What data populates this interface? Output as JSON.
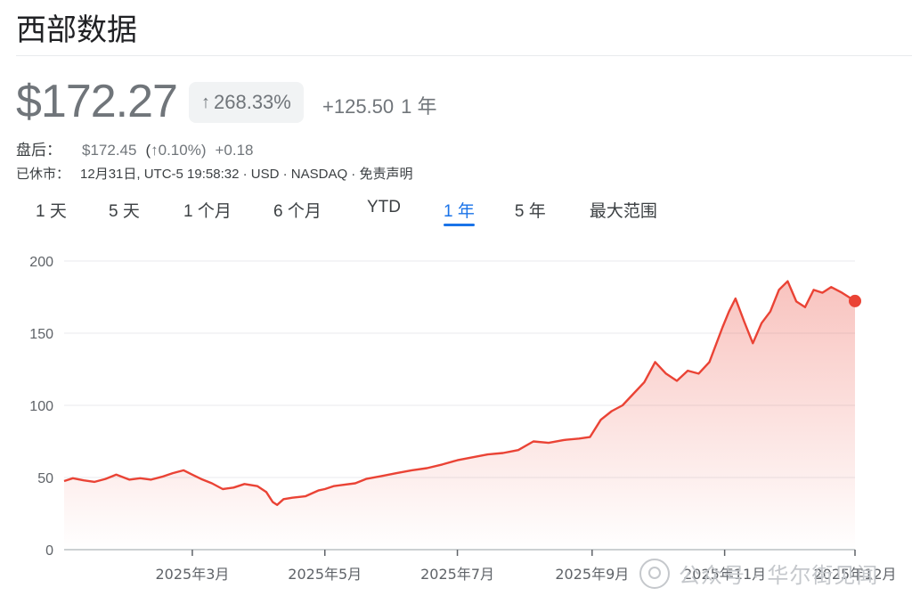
{
  "header": {
    "title": "西部数据"
  },
  "quote": {
    "price": "$172.27",
    "pct_change": "268.33%",
    "abs_change": "+125.50",
    "period": "1 年"
  },
  "after_hours": {
    "label": "盘后：",
    "price": "$172.45",
    "pct_open": "(",
    "pct": "0.10%)",
    "change": "+0.18"
  },
  "status": {
    "label": "已休市：",
    "detail": "12月31日, UTC-5 19:58:32 · USD · NASDAQ · 免责声明"
  },
  "tabs": [
    {
      "label": "1 天"
    },
    {
      "label": "5 天"
    },
    {
      "label": "1 个月"
    },
    {
      "label": "6 个月"
    },
    {
      "label": "YTD"
    },
    {
      "label": "1 年"
    },
    {
      "label": "5 年"
    },
    {
      "label": "最大范围"
    }
  ],
  "watermark": {
    "text": "公众号 · 华尔街见闻"
  },
  "colors": {
    "line": "#ea4335",
    "accent": "#1a73e8",
    "grid": "#e8eaed",
    "text_muted": "#70757a"
  },
  "icons": {
    "up_arrow": "arrow-up-icon"
  },
  "chart_data": {
    "type": "area",
    "ylim": [
      0,
      200
    ],
    "y_ticks": [
      "0",
      "50",
      "100",
      "150",
      "200"
    ],
    "x_ticks": [
      "2025年3月",
      "2025年5月",
      "2025年7月",
      "2025年9月",
      "2025年11月",
      "2025年12月"
    ],
    "x_tick_dates": [
      "2025-03-01",
      "2025-05-01",
      "2025-07-01",
      "2025-09-01",
      "2025-11-01",
      "2025-12-31"
    ],
    "x_range": [
      "2025-01-01",
      "2025-12-31"
    ],
    "grid": true,
    "legend": "none",
    "series": [
      {
        "points": [
          [
            "2025-01-01",
            47.5
          ],
          [
            "2025-01-05",
            49.5
          ],
          [
            "2025-01-10",
            48
          ],
          [
            "2025-01-15",
            47
          ],
          [
            "2025-01-20",
            49
          ],
          [
            "2025-01-25",
            52
          ],
          [
            "2025-01-31",
            48.5
          ],
          [
            "2025-02-05",
            49.5
          ],
          [
            "2025-02-10",
            48.5
          ],
          [
            "2025-02-15",
            50.5
          ],
          [
            "2025-02-20",
            53
          ],
          [
            "2025-02-25",
            55
          ],
          [
            "2025-03-01",
            52
          ],
          [
            "2025-03-05",
            49
          ],
          [
            "2025-03-10",
            46
          ],
          [
            "2025-03-15",
            42
          ],
          [
            "2025-03-20",
            43
          ],
          [
            "2025-03-25",
            45.5
          ],
          [
            "2025-03-31",
            44
          ],
          [
            "2025-04-04",
            40
          ],
          [
            "2025-04-07",
            33
          ],
          [
            "2025-04-09",
            31
          ],
          [
            "2025-04-12",
            35
          ],
          [
            "2025-04-16",
            36
          ],
          [
            "2025-04-22",
            37
          ],
          [
            "2025-04-28",
            41
          ],
          [
            "2025-05-01",
            42
          ],
          [
            "2025-05-05",
            44
          ],
          [
            "2025-05-10",
            45
          ],
          [
            "2025-05-15",
            46
          ],
          [
            "2025-05-20",
            49
          ],
          [
            "2025-05-27",
            51
          ],
          [
            "2025-06-03",
            53
          ],
          [
            "2025-06-10",
            55
          ],
          [
            "2025-06-17",
            56.5
          ],
          [
            "2025-06-24",
            59
          ],
          [
            "2025-07-01",
            62
          ],
          [
            "2025-07-08",
            64
          ],
          [
            "2025-07-15",
            66
          ],
          [
            "2025-07-22",
            67
          ],
          [
            "2025-07-29",
            69
          ],
          [
            "2025-08-05",
            75
          ],
          [
            "2025-08-12",
            74
          ],
          [
            "2025-08-19",
            76
          ],
          [
            "2025-08-26",
            77
          ],
          [
            "2025-08-31",
            78
          ],
          [
            "2025-09-05",
            90
          ],
          [
            "2025-09-10",
            96
          ],
          [
            "2025-09-15",
            100
          ],
          [
            "2025-09-20",
            108
          ],
          [
            "2025-09-25",
            116
          ],
          [
            "2025-09-30",
            130
          ],
          [
            "2025-10-05",
            122
          ],
          [
            "2025-10-10",
            117
          ],
          [
            "2025-10-15",
            124
          ],
          [
            "2025-10-20",
            122
          ],
          [
            "2025-10-25",
            130
          ],
          [
            "2025-10-31",
            154
          ],
          [
            "2025-11-03",
            165
          ],
          [
            "2025-11-06",
            174
          ],
          [
            "2025-11-10",
            158
          ],
          [
            "2025-11-14",
            143
          ],
          [
            "2025-11-18",
            157
          ],
          [
            "2025-11-22",
            165
          ],
          [
            "2025-11-26",
            180
          ],
          [
            "2025-11-30",
            186
          ],
          [
            "2025-12-04",
            172
          ],
          [
            "2025-12-08",
            168
          ],
          [
            "2025-12-12",
            180
          ],
          [
            "2025-12-16",
            178
          ],
          [
            "2025-12-20",
            182
          ],
          [
            "2025-12-25",
            178
          ],
          [
            "2025-12-31",
            172.27
          ]
        ]
      }
    ]
  }
}
